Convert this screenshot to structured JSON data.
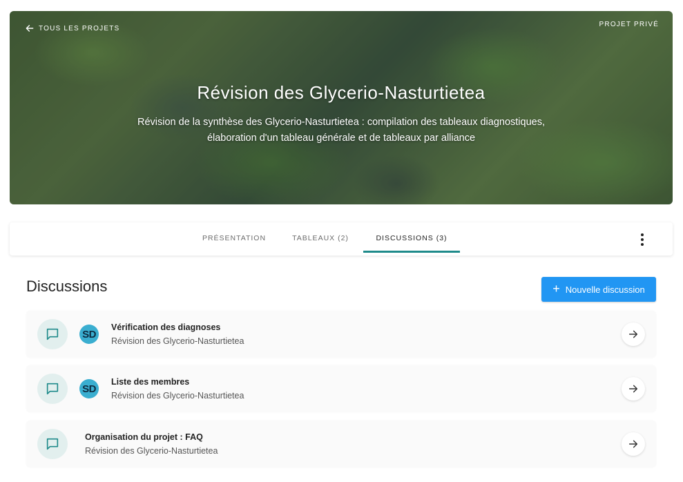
{
  "hero": {
    "back_label": "TOUS LES PROJETS",
    "privacy_label": "PROJET PRIVÉ",
    "title": "Révision des Glycerio-Nasturtietea",
    "description": "Révision de la synthèse des Glycerio-Nasturtietea : compilation des tableaux diagnostiques, élaboration d'un tableau générale et de tableaux par alliance"
  },
  "tabs": [
    {
      "label": "PRÉSENTATION",
      "active": false
    },
    {
      "label": "TABLEAUX (2)",
      "active": false
    },
    {
      "label": "DISCUSSIONS (3)",
      "active": true
    }
  ],
  "section": {
    "title": "Discussions",
    "new_button_label": "Nouvelle discussion"
  },
  "discussions": [
    {
      "title": "Vérification des diagnoses",
      "project": "Révision des Glycerio-Nasturtietea",
      "avatar": "SD"
    },
    {
      "title": "Liste des membres",
      "project": "Révision des Glycerio-Nasturtietea",
      "avatar": "SD"
    },
    {
      "title": "Organisation du projet : FAQ",
      "project": "Révision des Glycerio-Nasturtietea",
      "avatar": ""
    }
  ],
  "colors": {
    "accent": "#1e8a8a",
    "primary_button": "#2196f3",
    "avatar": "#3aaed0",
    "chat_icon_bg": "#e2efee"
  },
  "icons": {
    "back": "arrow-left-icon",
    "more": "more-vertical-icon",
    "new": "plus-icon",
    "chat": "chat-bubble-icon",
    "go": "arrow-right-icon"
  }
}
